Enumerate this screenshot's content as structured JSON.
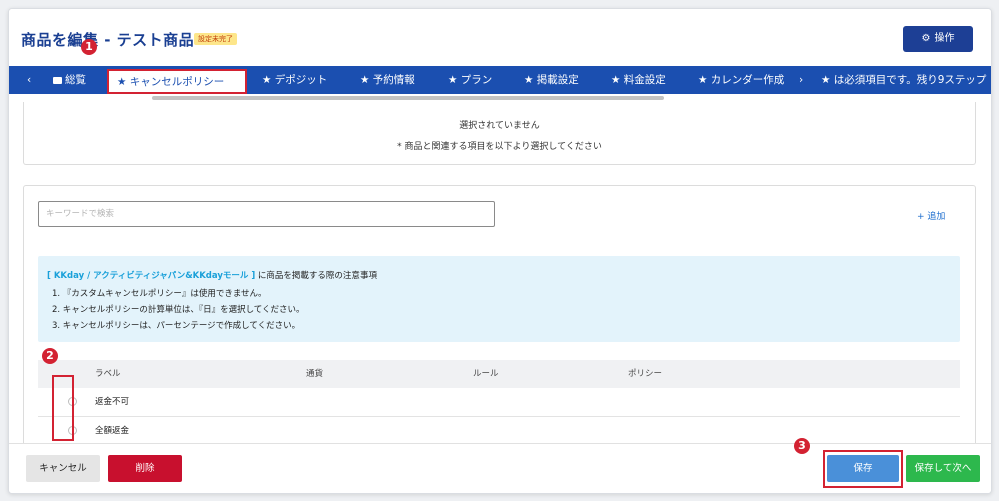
{
  "header": {
    "title": "商品を編集 - テスト商品",
    "status_badge": "設定未完了",
    "ops_button": "操作",
    "ops_icon": "gear-icon"
  },
  "tabs": {
    "prev_arrow": "‹",
    "items": [
      {
        "label": "総覧",
        "icon": "folder-icon"
      },
      {
        "label": "★ キャンセルポリシー",
        "active": true
      },
      {
        "label": "★ デポジット"
      },
      {
        "label": "★ 予約情報"
      },
      {
        "label": "★ プラン"
      },
      {
        "label": "★ 掲載設定"
      },
      {
        "label": "★ 料金設定"
      },
      {
        "label": "★ カレンダー作成"
      }
    ],
    "next_arrow": "›",
    "required_note": "★ は必須項目です。残り9ステップ"
  },
  "summary": {
    "not_selected": "選択されていません",
    "instruction": "* 商品と関連する項目を以下より選択してください"
  },
  "policy": {
    "search_placeholder": "キーワードで検索",
    "add_label": "+ 追加",
    "notice": {
      "highlight": "[ KKday / アクティビティジャパン&KKdayモール ]",
      "head_rest": " に商品を掲載する際の注意事項",
      "lines": [
        "1. 『カスタムキャンセルポリシー』は使用できません。",
        "2. キャンセルポリシーの計算単位は、『日』を選択してください。",
        "3. キャンセルポリシーは、パーセンテージで作成してください。"
      ]
    },
    "table": {
      "columns": [
        "ラベル",
        "通貨",
        "ルール",
        "ポリシー"
      ],
      "rows": [
        {
          "label": "返金不可"
        },
        {
          "label": "全額返金"
        }
      ]
    }
  },
  "footer": {
    "cancel": "キャンセル",
    "delete": "削除",
    "save": "保存",
    "save_next": "保存して次へ"
  },
  "annotations": {
    "step1": "1",
    "step2": "2",
    "step3": "3"
  },
  "colors": {
    "brand_blue": "#1b4fb0",
    "highlight_red": "#d32232",
    "save_blue": "#4a90d9",
    "save_next_green": "#2db84d",
    "delete_red": "#c8102e"
  }
}
